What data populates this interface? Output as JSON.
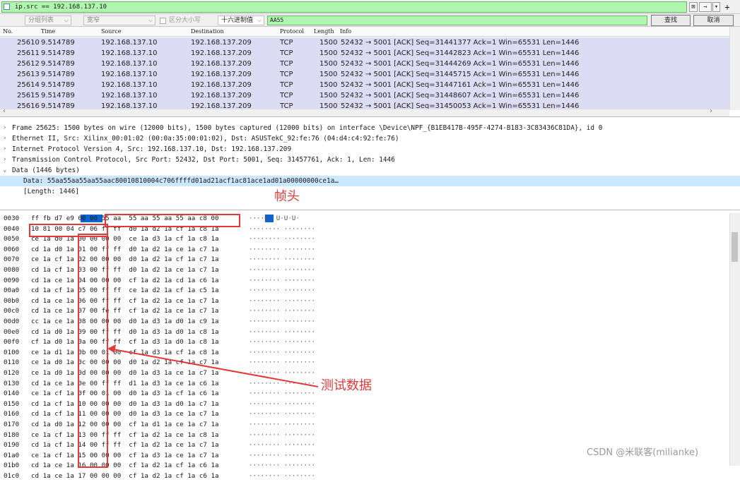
{
  "filter": {
    "value": "ip.src == 192.168.137.10",
    "clear_glyph": "⊠",
    "apply_glyph": "→",
    "dropdown_glyph": "▾",
    "add_glyph": "+"
  },
  "find": {
    "scope_label": "分组列表",
    "charset_label": "宽窄",
    "case_label": "区分大小写",
    "type_label": "十六进制值",
    "search_value": "AA55",
    "find_button": "查找",
    "cancel_button": "取消"
  },
  "packet_list": {
    "columns": [
      "No.",
      "Time",
      "Source",
      "Destination",
      "Protocol",
      "Length",
      "Info"
    ],
    "rows": [
      {
        "no": "25610",
        "time": "9.514789",
        "src": "192.168.137.10",
        "dst": "192.168.137.209",
        "proto": "TCP",
        "len": "1500",
        "info": "52432 → 5001 [ACK] Seq=31441377 Ack=1 Win=65531 Len=1446"
      },
      {
        "no": "25611",
        "time": "9.514789",
        "src": "192.168.137.10",
        "dst": "192.168.137.209",
        "proto": "TCP",
        "len": "1500",
        "info": "52432 → 5001 [ACK] Seq=31442823 Ack=1 Win=65531 Len=1446"
      },
      {
        "no": "25612",
        "time": "9.514789",
        "src": "192.168.137.10",
        "dst": "192.168.137.209",
        "proto": "TCP",
        "len": "1500",
        "info": "52432 → 5001 [ACK] Seq=31444269 Ack=1 Win=65531 Len=1446"
      },
      {
        "no": "25613",
        "time": "9.514789",
        "src": "192.168.137.10",
        "dst": "192.168.137.209",
        "proto": "TCP",
        "len": "1500",
        "info": "52432 → 5001 [ACK] Seq=31445715 Ack=1 Win=65531 Len=1446"
      },
      {
        "no": "25614",
        "time": "9.514789",
        "src": "192.168.137.10",
        "dst": "192.168.137.209",
        "proto": "TCP",
        "len": "1500",
        "info": "52432 → 5001 [ACK] Seq=31447161 Ack=1 Win=65531 Len=1446"
      },
      {
        "no": "25615",
        "time": "9.514789",
        "src": "192.168.137.10",
        "dst": "192.168.137.209",
        "proto": "TCP",
        "len": "1500",
        "info": "52432 → 5001 [ACK] Seq=31448607 Ack=1 Win=65531 Len=1446"
      },
      {
        "no": "25616",
        "time": "9.514789",
        "src": "192.168.137.10",
        "dst": "192.168.137.209",
        "proto": "TCP",
        "len": "1500",
        "info": "52432 → 5001 [ACK] Seq=31450053 Ack=1 Win=65531 Len=1446"
      }
    ]
  },
  "details": {
    "rows": [
      {
        "toggle": "›",
        "text": "Frame 25625: 1500 bytes on wire (12000 bits), 1500 bytes captured (12000 bits) on interface \\Device\\NPF_{B1EB417B-495F-4274-B183-3C83436C81DA}, id 0"
      },
      {
        "toggle": "›",
        "text": "Ethernet II, Src: Xilinx_00:01:02 (00:0a:35:00:01:02), Dst: ASUSTekC_92:fe:76 (04:d4:c4:92:fe:76)"
      },
      {
        "toggle": "›",
        "text": "Internet Protocol Version 4, Src: 192.168.137.10, Dst: 192.168.137.209"
      },
      {
        "toggle": "›",
        "text": "Transmission Control Protocol, Src Port: 52432, Dst Port: 5001, Seq: 31457761, Ack: 1, Len: 1446"
      },
      {
        "toggle": "⌄",
        "text": "Data (1446 bytes)"
      },
      {
        "toggle": "",
        "text": "Data: 55aa55aa55aa55aac80010810004c706ffffd01ad21acf1ac81ace1ad01a00000000ce1a…"
      },
      {
        "toggle": "",
        "text": "[Length: 1446]"
      }
    ]
  },
  "bytes": {
    "rows": [
      {
        "off": "0030",
        "hex": "ff fb d7 e9 00 00 55 aa  55 aa 55 aa 55 aa c8 00",
        "asc": "····U· U·U·U·"
      },
      {
        "off": "0040",
        "hex": "10 81 00 04 c7 06 ff ff  d0 1a d2 1a cf 1a c8 1a",
        "asc": "········ ········"
      },
      {
        "off": "0050",
        "hex": "ce 1a d0 1a 00 00 00 00  ce 1a d3 1a cf 1a c8 1a",
        "asc": "········ ········"
      },
      {
        "off": "0060",
        "hex": "cd 1a d0 1a 01 00 ff ff  d0 1a d2 1a ce 1a c7 1a",
        "asc": "········ ········"
      },
      {
        "off": "0070",
        "hex": "ce 1a cf 1a 02 00 00 00  d0 1a d2 1a cf 1a c7 1a",
        "asc": "········ ········"
      },
      {
        "off": "0080",
        "hex": "cd 1a cf 1a 03 00 ff ff  d0 1a d2 1a ce 1a c7 1a",
        "asc": "········ ········"
      },
      {
        "off": "0090",
        "hex": "cd 1a ce 1a 04 00 00 00  cf 1a d2 1a cd 1a c6 1a",
        "asc": "········ ········"
      },
      {
        "off": "00a0",
        "hex": "cd 1a cf 1a 05 00 ff ff  ce 1a d2 1a cf 1a c5 1a",
        "asc": "········ ········"
      },
      {
        "off": "00b0",
        "hex": "cd 1a ce 1a 06 00 ff ff  cf 1a d2 1a ce 1a c7 1a",
        "asc": "········ ········"
      },
      {
        "off": "00c0",
        "hex": "cd 1a ce 1a 07 00 fe ff  cf 1a d2 1a ce 1a c7 1a",
        "asc": "········ ········"
      },
      {
        "off": "00d0",
        "hex": "cc 1a ce 1a 08 00 00 00  d0 1a d3 1a d0 1a c9 1a",
        "asc": "········ ········"
      },
      {
        "off": "00e0",
        "hex": "cd 1a d0 1a 09 00 ff ff  d0 1a d3 1a d0 1a c8 1a",
        "asc": "········ ········"
      },
      {
        "off": "00f0",
        "hex": "cf 1a d0 1a 0a 00 ff ff  cf 1a d3 1a d0 1a c8 1a",
        "asc": "········ ········"
      },
      {
        "off": "0100",
        "hex": "ce 1a d1 1a 0b 00 01 00  cf 1a d3 1a cf 1a c8 1a",
        "asc": "········ ········"
      },
      {
        "off": "0110",
        "hex": "ce 1a d0 1a 0c 00 00 00  d0 1a d2 1a cf 1a c7 1a",
        "asc": "········ ········"
      },
      {
        "off": "0120",
        "hex": "ce 1a d0 1a 0d 00 00 00  d0 1a d3 1a ce 1a c7 1a",
        "asc": "········ ········"
      },
      {
        "off": "0130",
        "hex": "cd 1a ce 1a 0e 00 ff ff  d1 1a d3 1a ce 1a c6 1a",
        "asc": "········ ········"
      },
      {
        "off": "0140",
        "hex": "ce 1a cf 1a 0f 00 01 00  d0 1a d3 1a cf 1a c6 1a",
        "asc": "········ ········"
      },
      {
        "off": "0150",
        "hex": "cd 1a cf 1a 10 00 00 00  d0 1a d3 1a d0 1a c7 1a",
        "asc": "········ ········"
      },
      {
        "off": "0160",
        "hex": "cd 1a cf 1a 11 00 00 00  d0 1a d3 1a ce 1a c7 1a",
        "asc": "········ ········"
      },
      {
        "off": "0170",
        "hex": "cd 1a d0 1a 12 00 00 00  cf 1a d1 1a ce 1a c7 1a",
        "asc": "········ ········"
      },
      {
        "off": "0180",
        "hex": "ce 1a cf 1a 13 00 ff ff  cf 1a d2 1a ce 1a c8 1a",
        "asc": "········ ········"
      },
      {
        "off": "0190",
        "hex": "cd 1a cf 1a 14 00 ff ff  cf 1a d2 1a ce 1a c7 1a",
        "asc": "········ ········"
      },
      {
        "off": "01a0",
        "hex": "ce 1a cf 1a 15 00 00 00  cf 1a d3 1a ce 1a c7 1a",
        "asc": "········ ········"
      },
      {
        "off": "01b0",
        "hex": "cd 1a ce 1a 16 00 00 00  cf 1a d2 1a cf 1a c6 1a",
        "asc": "········ ········"
      },
      {
        "off": "01c0",
        "hex": "cd 1a ce 1a 17 00 00 00  cf 1a d2 1a cf 1a c6 1a",
        "asc": "········ ········"
      }
    ]
  },
  "annotations": {
    "frame_header": "帧头",
    "test_data": "测试数据"
  },
  "watermark": "CSDN @米联客(milianke)",
  "colors": {
    "filter_ok": "#aff6ae",
    "row_selected": "#dcdcf4",
    "annotation": "#e03a3a",
    "byte_highlight": "#0a64d4"
  }
}
